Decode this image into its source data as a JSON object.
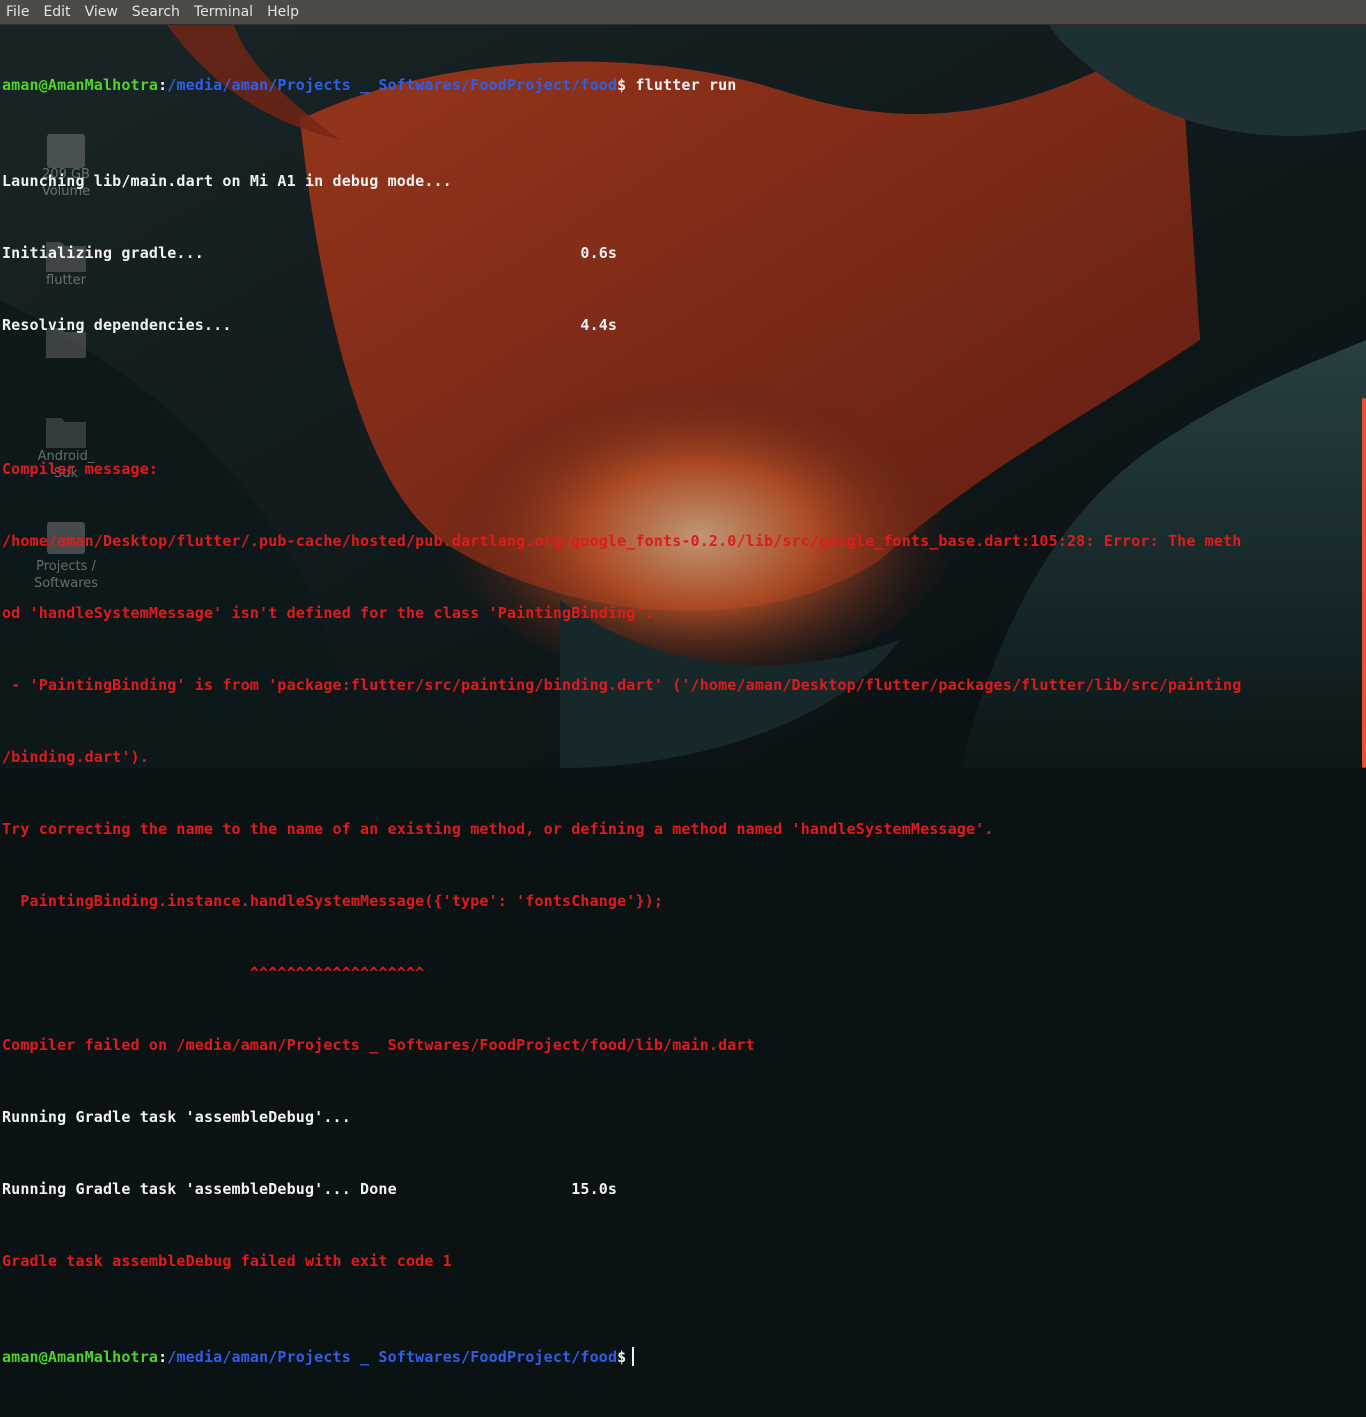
{
  "menubar": {
    "items": [
      "File",
      "Edit",
      "View",
      "Search",
      "Terminal",
      "Help"
    ]
  },
  "desktop": {
    "icons": [
      {
        "name": "volume-drive-icon",
        "label": "209 GB\nVolume"
      },
      {
        "name": "flutter-folder-icon",
        "label": "flutter"
      },
      {
        "name": "folder-icon",
        "label": ""
      },
      {
        "name": "android-sdk-folder-icon",
        "label": "Android_\nSdk"
      },
      {
        "name": "projects-drive-icon",
        "label": "Projects /\nSoftwares"
      }
    ]
  },
  "prompt": {
    "user_host": "aman@AmanMalhotra",
    "separator": ":",
    "path": "/media/aman/Projects _ Softwares/FoodProject/food",
    "symbol": "$"
  },
  "command": " flutter run",
  "output": [
    {
      "text": "Launching lib/main.dart on Mi A1 in debug mode...",
      "color": "white"
    },
    {
      "text": "Initializing gradle...                                         0.6s",
      "color": "white"
    },
    {
      "text": "Resolving dependencies...                                      4.4s",
      "color": "white"
    },
    {
      "text": "",
      "color": "white"
    },
    {
      "text": "Compiler message:",
      "color": "red"
    },
    {
      "text": "/home/aman/Desktop/flutter/.pub-cache/hosted/pub.dartlang.org/google_fonts-0.2.0/lib/src/google_fonts_base.dart:105:28: Error: The meth",
      "color": "red"
    },
    {
      "text": "od 'handleSystemMessage' isn't defined for the class 'PaintingBinding'.",
      "color": "red"
    },
    {
      "text": " - 'PaintingBinding' is from 'package:flutter/src/painting/binding.dart' ('/home/aman/Desktop/flutter/packages/flutter/lib/src/painting",
      "color": "red"
    },
    {
      "text": "/binding.dart').",
      "color": "red"
    },
    {
      "text": "Try correcting the name to the name of an existing method, or defining a method named 'handleSystemMessage'.",
      "color": "red"
    },
    {
      "text": "  PaintingBinding.instance.handleSystemMessage({'type': 'fontsChange'});",
      "color": "red"
    },
    {
      "text": "                           ^^^^^^^^^^^^^^^^^^^",
      "color": "red"
    },
    {
      "text": "Compiler failed on /media/aman/Projects _ Softwares/FoodProject/food/lib/main.dart",
      "color": "red"
    },
    {
      "text": "Running Gradle task 'assembleDebug'...",
      "color": "white"
    },
    {
      "text": "Running Gradle task 'assembleDebug'... Done                   15.0s",
      "color": "white"
    },
    {
      "text": "Gradle task assembleDebug failed with exit code 1",
      "color": "red"
    }
  ],
  "colors": {
    "terminal_text": "#f2f2f2",
    "error": "#e01b1b",
    "prompt_user": "#4fd42c",
    "prompt_path": "#2f5fe8",
    "menubar_bg": "#4b4a46",
    "scrollbar": "#e4552b"
  }
}
